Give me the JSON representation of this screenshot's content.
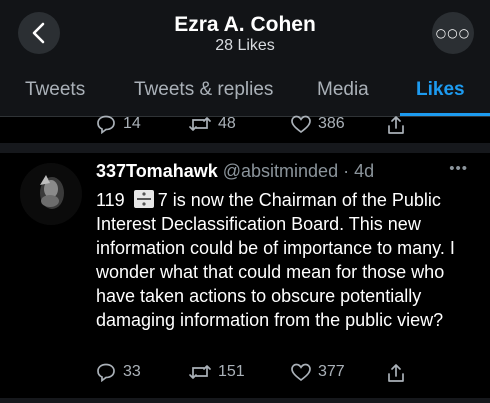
{
  "header": {
    "title": "Ezra A. Cohen",
    "subtitle": "28 Likes"
  },
  "tabs": [
    {
      "label": "Tweets",
      "active": false
    },
    {
      "label": "Tweets & replies",
      "active": false
    },
    {
      "label": "Media",
      "active": false
    },
    {
      "label": "Likes",
      "active": true
    }
  ],
  "prev_tweet": {
    "replies": "14",
    "retweets": "48",
    "likes": "386"
  },
  "tweet": {
    "author": "337Tomahawk",
    "handle": "@absitminded",
    "time": "4d",
    "text_prefix": "119",
    "text_number": "7",
    "text_body": "is now the Chairman of the Public Interest Declassification Board. This new information could be of importance to many. I wonder what that could mean for those who have taken actions to obscure potentially damaging information from the public view?",
    "replies": "33",
    "retweets": "151",
    "likes": "377"
  },
  "colors": {
    "accent": "#1d9bf0",
    "background": "#000000",
    "header_background": "#121417",
    "muted_text": "#8b949b"
  },
  "icons": [
    "back-arrow-icon",
    "more-icon",
    "reply-icon",
    "retweet-icon",
    "like-icon",
    "share-icon",
    "divide-icon"
  ]
}
